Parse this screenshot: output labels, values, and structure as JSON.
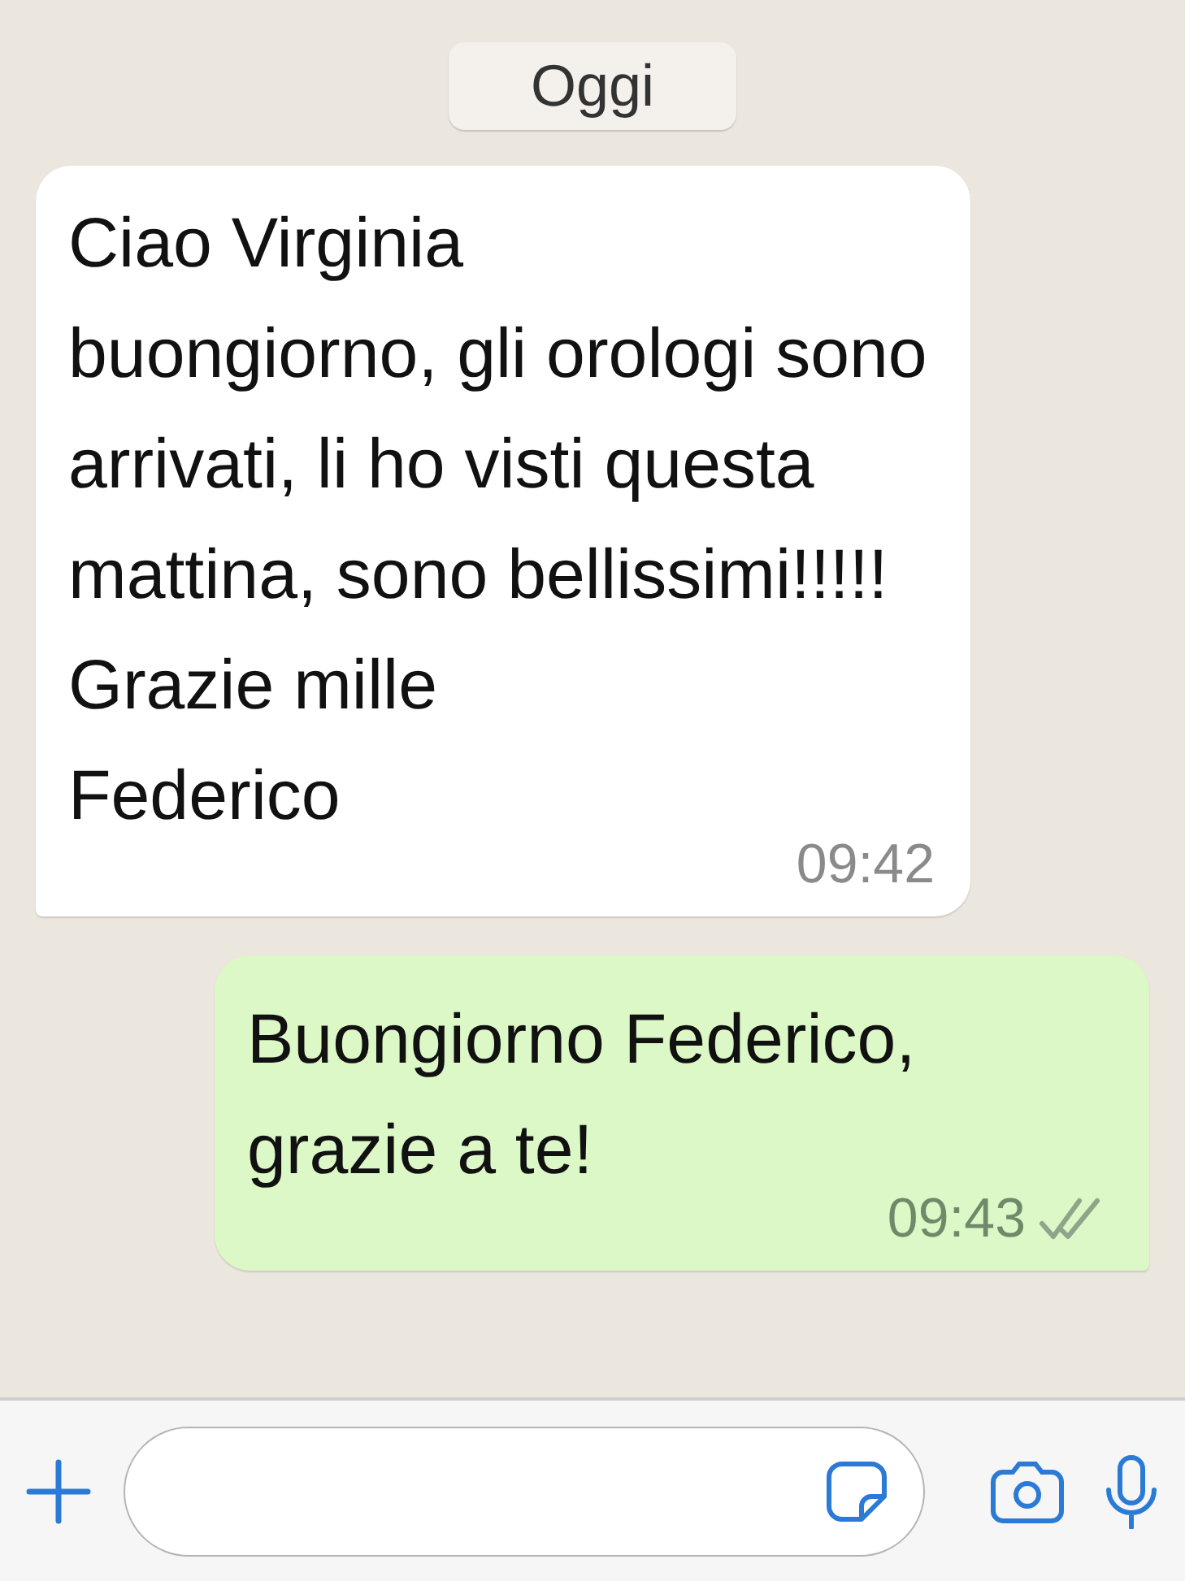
{
  "date_divider": "Oggi",
  "messages": [
    {
      "kind": "incoming",
      "text": "Ciao Virginia\nbuongiorno, gli orologi sono arrivati, li ho visti questa mattina, sono bellissimi!!!!!\nGrazie mille\nFederico",
      "time": "09:42"
    },
    {
      "kind": "outgoing",
      "text": "Buongiorno Federico, grazie a te!",
      "time": "09:43",
      "read": false
    }
  ]
}
